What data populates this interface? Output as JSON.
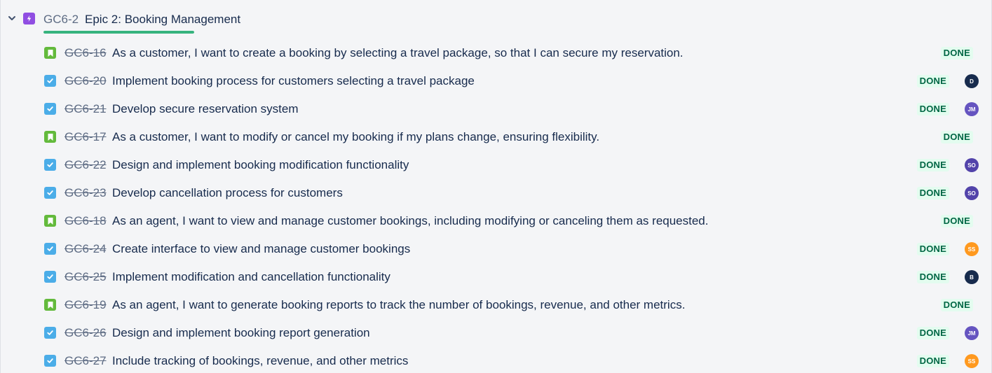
{
  "epic": {
    "key": "GC6-2",
    "title": "Epic 2: Booking Management",
    "progress": 1.0,
    "icon": "lightning-bolt-icon",
    "icon_color": "#904ee2",
    "progress_color": "#36b37e"
  },
  "status_colors": {
    "done_bg": "#e3fcef",
    "done_text": "#006644"
  },
  "issues": [
    {
      "type": "story",
      "key": "GC6-16",
      "summary": "As a customer, I want to create a booking by selecting a travel package, so that I can secure my reservation.",
      "status": "DONE",
      "assignee": null,
      "assignee_color": null
    },
    {
      "type": "task",
      "key": "GC6-20",
      "summary": "Implement booking process for customers selecting a travel package",
      "status": "DONE",
      "assignee": "D",
      "assignee_color": "#172b4d"
    },
    {
      "type": "task",
      "key": "GC6-21",
      "summary": "Develop secure reservation system",
      "status": "DONE",
      "assignee": "JM",
      "assignee_color": "#6554c0"
    },
    {
      "type": "story",
      "key": "GC6-17",
      "summary": "As a customer, I want to modify or cancel my booking if my plans change, ensuring flexibility.",
      "status": "DONE",
      "assignee": null,
      "assignee_color": null
    },
    {
      "type": "task",
      "key": "GC6-22",
      "summary": "Design and implement booking modification functionality",
      "status": "DONE",
      "assignee": "SO",
      "assignee_color": "#5243aa"
    },
    {
      "type": "task",
      "key": "GC6-23",
      "summary": "Develop cancellation process for customers",
      "status": "DONE",
      "assignee": "SO",
      "assignee_color": "#5243aa"
    },
    {
      "type": "story",
      "key": "GC6-18",
      "summary": "As an agent, I want to view and manage customer bookings, including modifying or canceling them as requested.",
      "status": "DONE",
      "assignee": null,
      "assignee_color": null
    },
    {
      "type": "task",
      "key": "GC6-24",
      "summary": "Create interface to view and manage customer bookings",
      "status": "DONE",
      "assignee": "SS",
      "assignee_color": "#ff991f"
    },
    {
      "type": "task",
      "key": "GC6-25",
      "summary": "Implement modification and cancellation functionality",
      "status": "DONE",
      "assignee": "B",
      "assignee_color": "#172b4d"
    },
    {
      "type": "story",
      "key": "GC6-19",
      "summary": "As an agent, I want to generate booking reports to track the number of bookings, revenue, and other metrics.",
      "status": "DONE",
      "assignee": null,
      "assignee_color": null
    },
    {
      "type": "task",
      "key": "GC6-26",
      "summary": "Design and implement booking report generation",
      "status": "DONE",
      "assignee": "JM",
      "assignee_color": "#6554c0"
    },
    {
      "type": "task",
      "key": "GC6-27",
      "summary": "Include tracking of bookings, revenue, and other metrics",
      "status": "DONE",
      "assignee": "SS",
      "assignee_color": "#ff991f"
    }
  ]
}
